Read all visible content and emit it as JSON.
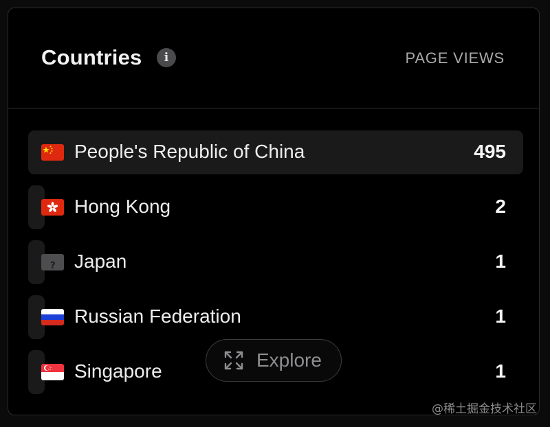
{
  "card": {
    "title": "Countries",
    "info_icon": "i",
    "column_label": "PAGE VIEWS"
  },
  "rows": [
    {
      "flag": "flag-china-icon",
      "name": "People's Republic of China",
      "count": "495",
      "share": 1.0
    },
    {
      "flag": "flag-hong-kong-icon",
      "name": "Hong Kong",
      "count": "2",
      "share": 0.004
    },
    {
      "flag": "unknown-flag-icon",
      "name": "Japan",
      "count": "1",
      "share": 0.002
    },
    {
      "flag": "flag-russia-icon",
      "name": "Russian Federation",
      "count": "1",
      "share": 0.002
    },
    {
      "flag": "flag-singapore-icon",
      "name": "Singapore",
      "count": "1",
      "share": 0.002
    }
  ],
  "explore": {
    "icon": "expand-icon",
    "label": "Explore"
  },
  "watermark": "@稀土掘金技术社区",
  "colors": {
    "background": "#000000",
    "row_bar": "#1a1a1b",
    "text": "#ededed",
    "muted": "#a8a8aa"
  }
}
